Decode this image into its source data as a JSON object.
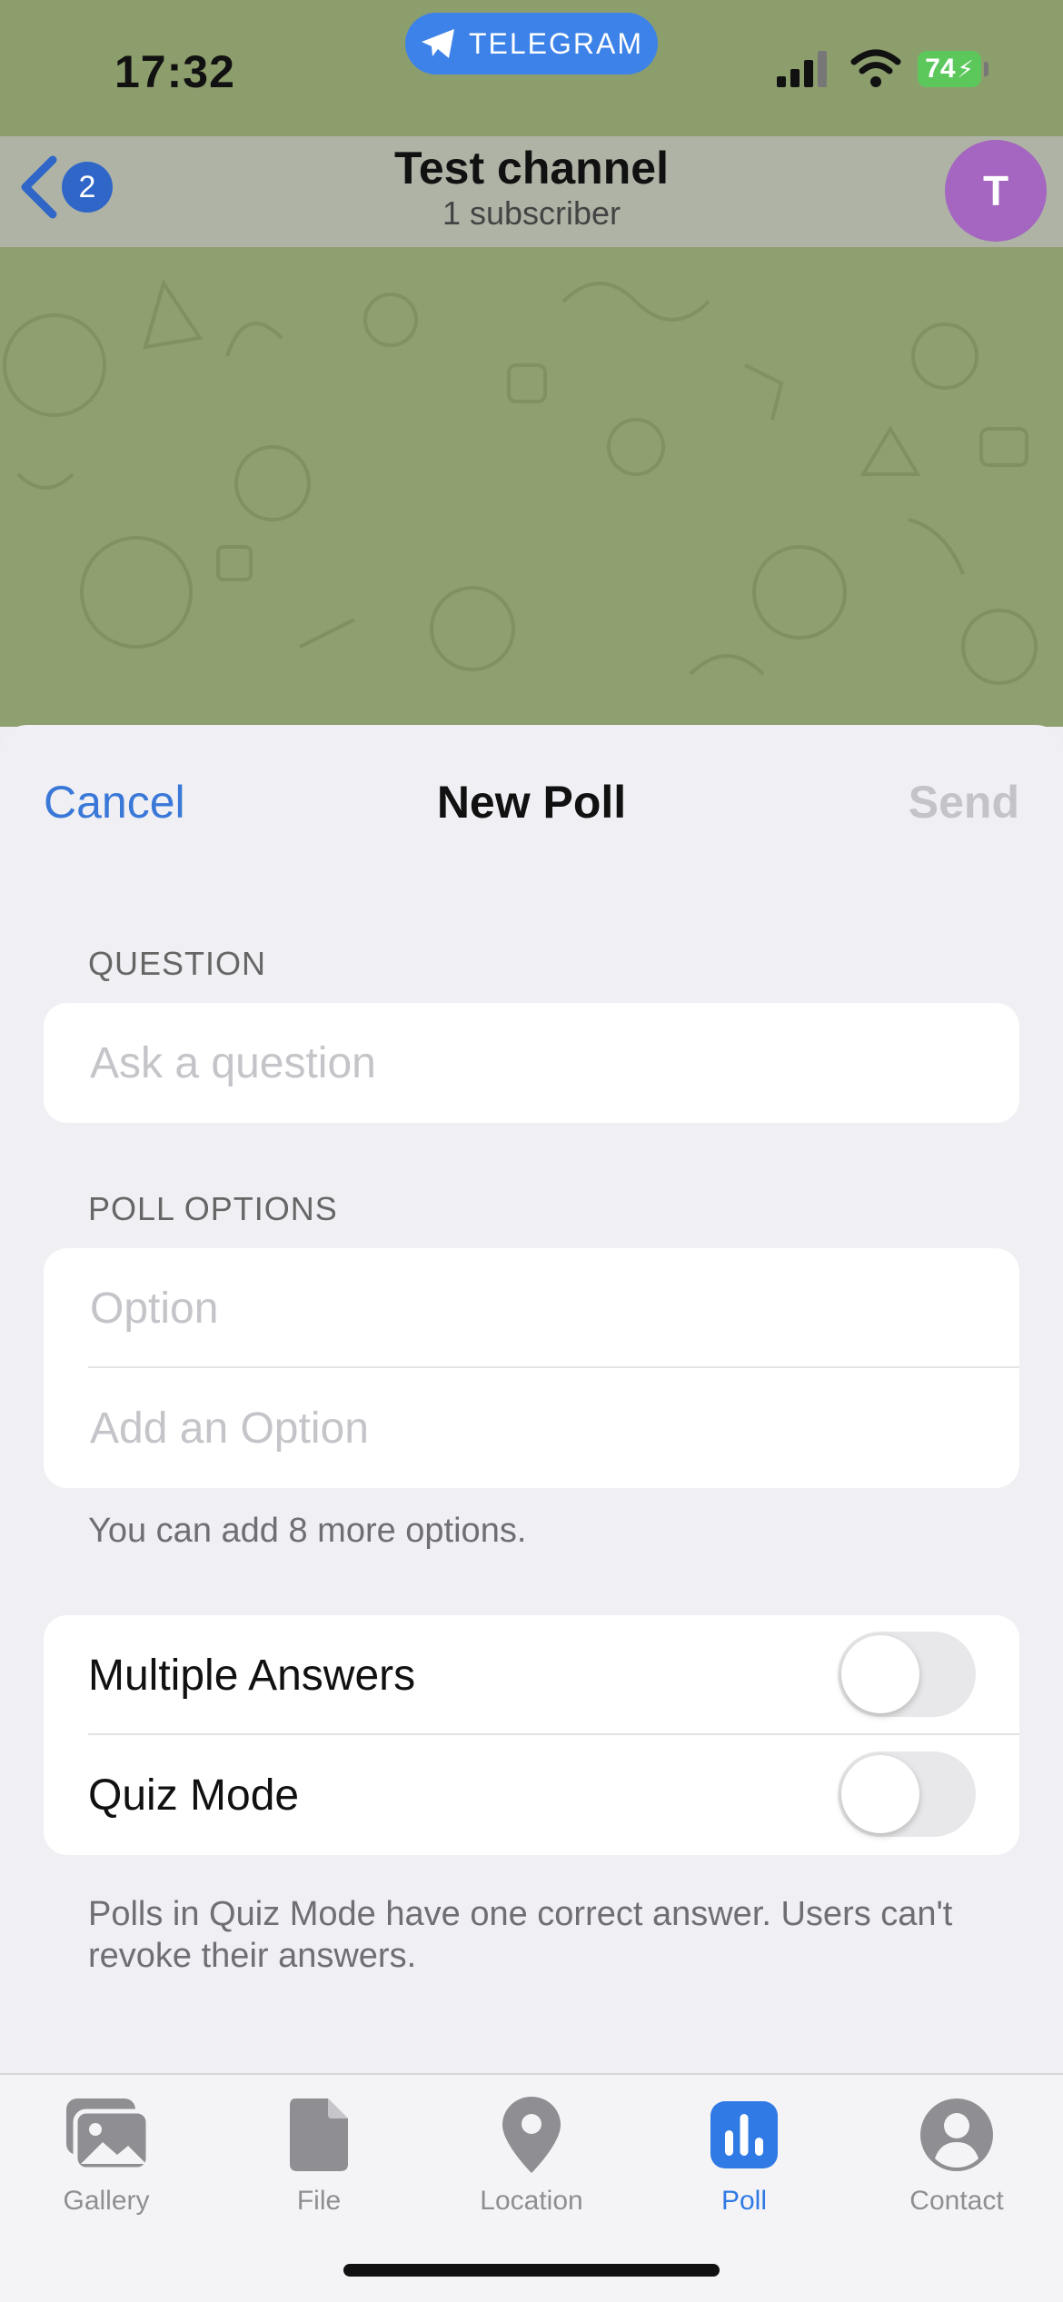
{
  "status_bar": {
    "time": "17:32",
    "app_pill": "TELEGRAM",
    "battery": "74"
  },
  "chat_header": {
    "back_badge": "2",
    "title": "Test channel",
    "subtitle": "1 subscriber",
    "avatar_letter": "T"
  },
  "sheet": {
    "cancel_label": "Cancel",
    "title": "New Poll",
    "send_label": "Send",
    "question": {
      "section_label": "QUESTION",
      "placeholder": "Ask a question",
      "value": ""
    },
    "options": {
      "section_label": "POLL OPTIONS",
      "items": [
        {
          "placeholder": "Option",
          "value": ""
        },
        {
          "placeholder": "Add an Option",
          "value": ""
        }
      ],
      "hint": "You can add 8 more options."
    },
    "settings": {
      "multiple_answers": {
        "label": "Multiple Answers",
        "enabled": false
      },
      "quiz_mode": {
        "label": "Quiz Mode",
        "enabled": false
      }
    },
    "quiz_footnote": "Polls in Quiz Mode have one correct answer. Users can't revoke their answers."
  },
  "tab_bar": {
    "tabs": [
      {
        "label": "Gallery",
        "icon": "gallery-icon",
        "active": false
      },
      {
        "label": "File",
        "icon": "file-icon",
        "active": false
      },
      {
        "label": "Location",
        "icon": "location-icon",
        "active": false
      },
      {
        "label": "Poll",
        "icon": "poll-icon",
        "active": true
      },
      {
        "label": "Contact",
        "icon": "contact-icon",
        "active": false
      }
    ]
  },
  "colors": {
    "accent": "#3a78d8",
    "send_disabled": "#c3c3c8",
    "wallpaper": "#8d9e6d",
    "avatar": "#a466c0"
  }
}
